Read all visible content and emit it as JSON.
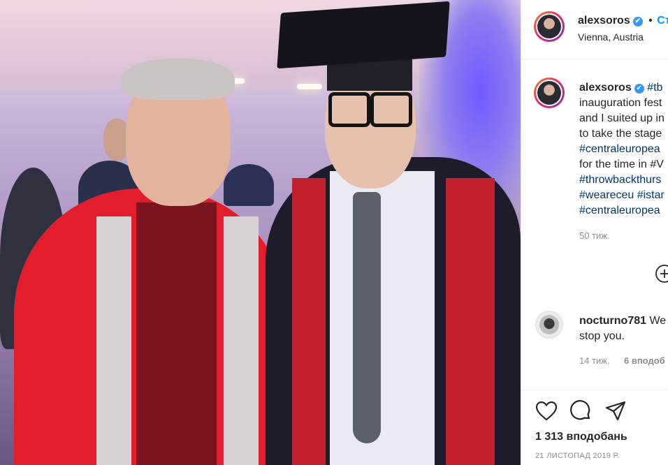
{
  "post": {
    "username": "alexsoros",
    "verified_mark": "✔",
    "separator": "•",
    "follow_label": "Ст",
    "location": "Vienna, Austria"
  },
  "caption": {
    "username": "alexsoros",
    "lines": [
      {
        "text": "#tb",
        "is_tag": true
      },
      {
        "text": "inauguration fest",
        "is_tag": false
      },
      {
        "text": "and I suited up in",
        "is_tag": false
      },
      {
        "text": "to take the stage",
        "is_tag": false
      },
      {
        "text": "#centraleuropea",
        "is_tag": true
      },
      {
        "text": "for the time in #V",
        "is_tag": false
      },
      {
        "text": "#throwbackthurs",
        "is_tag": true
      },
      {
        "text": "#weareceu #istar",
        "is_tag": true
      },
      {
        "text": "#centraleuropea",
        "is_tag": true
      }
    ],
    "time_ago": "50 тиж."
  },
  "comment": {
    "username": "nocturno781",
    "text_start": "We",
    "text_line2": "stop you.",
    "time_ago": "14 тиж.",
    "likes": "6 вподоб"
  },
  "actions": {
    "like_icon": "heart-icon",
    "comment_icon": "comment-bubble-icon",
    "share_icon": "paper-plane-icon",
    "more_icon": "plus-circle-icon",
    "likes_count": "1 313 вподобань",
    "date": "21 ЛИСТОПАД 2019 Р."
  },
  "colors": {
    "tag": "#00376b",
    "verified": "#3897f0",
    "muted": "#8e8e8e",
    "text": "#262626"
  }
}
